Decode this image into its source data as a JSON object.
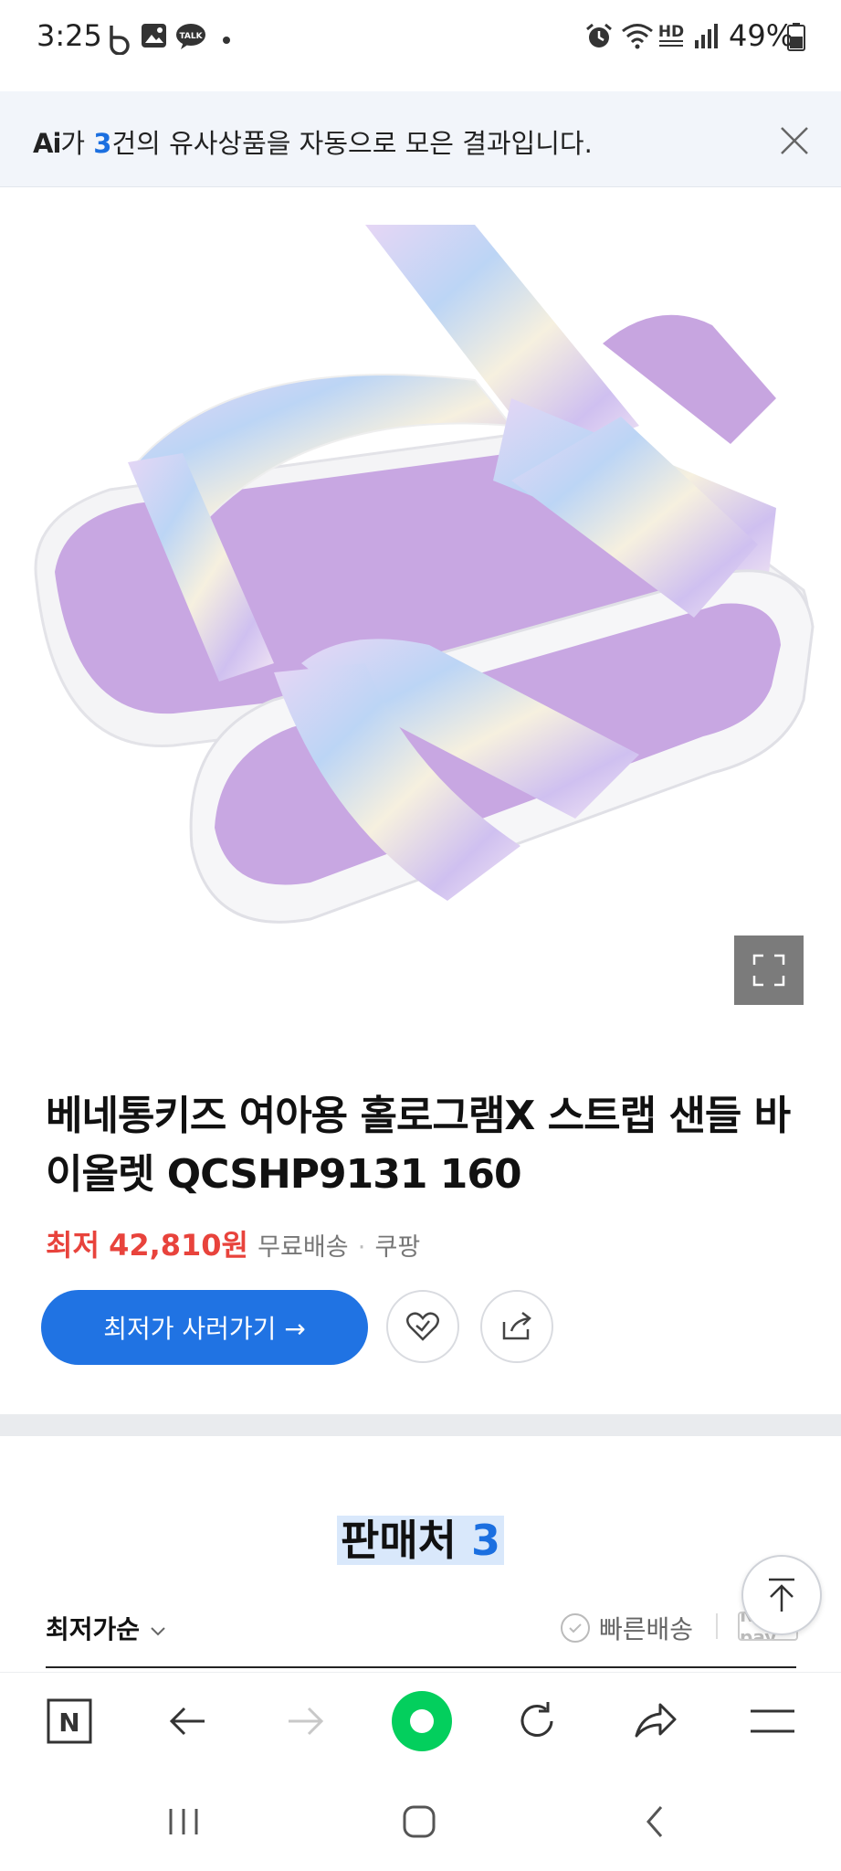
{
  "status_bar": {
    "time": "3:25",
    "battery": "49%",
    "icons": [
      "b-app-icon",
      "gallery-icon",
      "talk-icon",
      "dot-icon",
      "alarm-icon",
      "wifi-icon",
      "hd-voice-icon",
      "signal-icon",
      "battery-icon"
    ],
    "hd_label": "HD",
    "talk_label": "TALK"
  },
  "ai_banner": {
    "logo": "Ai",
    "prefix": "가 ",
    "count": "3",
    "suffix": "건의 유사상품을 자동으로 모은 결과입니다."
  },
  "product": {
    "title": "베네통키즈 여아용 홀로그램X 스트랩 샌들 바이올렛 QCSHP9131 160",
    "price_label": "최저",
    "price_value": "42,810원",
    "shipping": "무료배송",
    "separator": "·",
    "seller": "쿠팡",
    "buy_button": "최저가 사러가기 →",
    "colors": {
      "accent": "#2073e3",
      "price": "#e8433c",
      "sandal": "#c9a8e3"
    }
  },
  "sellers": {
    "title": "판매처",
    "count": "3",
    "sort_label": "최저가순",
    "fast_shipping": "빠른배송",
    "npay_label": "N pay"
  },
  "browser_toolbar": {
    "items": [
      "naver-home-icon",
      "back-icon",
      "forward-icon",
      "green-dot-icon",
      "refresh-icon",
      "share-icon",
      "menu-icon"
    ],
    "home_label": "N"
  }
}
